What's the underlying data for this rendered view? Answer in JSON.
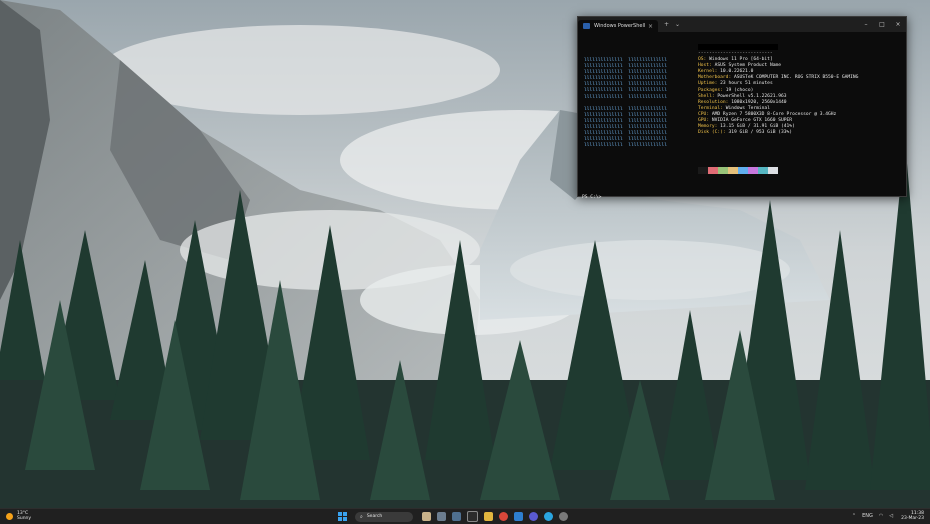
{
  "terminal": {
    "tab_title": "Windows PowerShell",
    "tab_close": "×",
    "new_tab": "+",
    "dropdown": "⌄",
    "minimize": "–",
    "maximize": "□",
    "close": "×",
    "separator": "---------------------------",
    "info": [
      {
        "key": "OS",
        "value": "Windows 11 Pro [64-bit]"
      },
      {
        "key": "Host",
        "value": "ASUS System Product Name"
      },
      {
        "key": "Kernel",
        "value": "10.0.22621.0"
      },
      {
        "key": "Motherboard",
        "value": "ASUSTeK COMPUTER INC. ROG STRIX B550-E GAMING"
      },
      {
        "key": "Uptime",
        "value": "23 hours 51 minutes"
      },
      {
        "key": "Packages",
        "value": "19 (choco)"
      },
      {
        "key": "Shell",
        "value": "PowerShell v5.1.22621.963"
      },
      {
        "key": "Resolution",
        "value": "1080x1920, 2560x1440"
      },
      {
        "key": "Terminal",
        "value": "Windows Terminal"
      },
      {
        "key": "CPU",
        "value": "AMD Ryzen 7 5800X3D 8-Core Processor @ 3.4GHz"
      },
      {
        "key": "GPU",
        "value": "NVIDIA GeForce GTX 1660 SUPER"
      },
      {
        "key": "Memory",
        "value": "13.15 GiB / 31.91 GiB (41%)"
      },
      {
        "key": "Disk (C:)",
        "value": "319 GiB / 953 GiB (33%)"
      }
    ],
    "prompt": "PS C:\\>",
    "logo_glyph": "llllllllllllll  llllllllllllll",
    "palette": [
      "#1a1a1a",
      "#e06c75",
      "#98c379",
      "#e5c07b",
      "#61afef",
      "#c678dd",
      "#56b6c2",
      "#dcdfe4"
    ]
  },
  "taskbar": {
    "weather_temp": "13°C",
    "weather_desc": "Sunny",
    "search_label": "Search",
    "tray_lang": "ENG",
    "time": "11:38",
    "date": "23-Mar-23"
  },
  "colors": {
    "logo": "#6fb1e8",
    "key": "#f0c24a",
    "taskbar": "#202020"
  }
}
